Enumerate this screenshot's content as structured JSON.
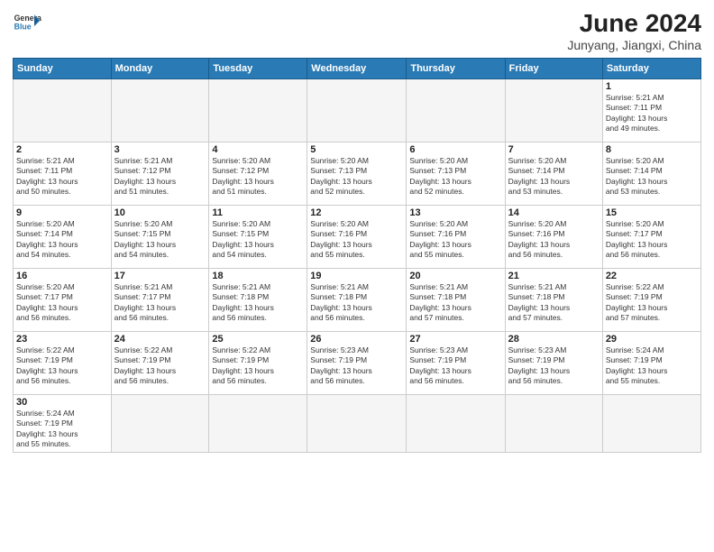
{
  "header": {
    "logo_general": "General",
    "logo_blue": "Blue",
    "month_year": "June 2024",
    "location": "Junyang, Jiangxi, China"
  },
  "days_of_week": [
    "Sunday",
    "Monday",
    "Tuesday",
    "Wednesday",
    "Thursday",
    "Friday",
    "Saturday"
  ],
  "weeks": [
    {
      "days": [
        {
          "num": "",
          "info": "",
          "empty": true
        },
        {
          "num": "",
          "info": "",
          "empty": true
        },
        {
          "num": "",
          "info": "",
          "empty": true
        },
        {
          "num": "",
          "info": "",
          "empty": true
        },
        {
          "num": "",
          "info": "",
          "empty": true
        },
        {
          "num": "",
          "info": "",
          "empty": true
        },
        {
          "num": "1",
          "info": "Sunrise: 5:21 AM\nSunset: 7:11 PM\nDaylight: 13 hours\nand 49 minutes.",
          "empty": false
        }
      ]
    },
    {
      "days": [
        {
          "num": "2",
          "info": "Sunrise: 5:21 AM\nSunset: 7:11 PM\nDaylight: 13 hours\nand 50 minutes.",
          "empty": false
        },
        {
          "num": "3",
          "info": "Sunrise: 5:21 AM\nSunset: 7:12 PM\nDaylight: 13 hours\nand 51 minutes.",
          "empty": false
        },
        {
          "num": "4",
          "info": "Sunrise: 5:20 AM\nSunset: 7:12 PM\nDaylight: 13 hours\nand 51 minutes.",
          "empty": false
        },
        {
          "num": "5",
          "info": "Sunrise: 5:20 AM\nSunset: 7:13 PM\nDaylight: 13 hours\nand 52 minutes.",
          "empty": false
        },
        {
          "num": "6",
          "info": "Sunrise: 5:20 AM\nSunset: 7:13 PM\nDaylight: 13 hours\nand 52 minutes.",
          "empty": false
        },
        {
          "num": "7",
          "info": "Sunrise: 5:20 AM\nSunset: 7:14 PM\nDaylight: 13 hours\nand 53 minutes.",
          "empty": false
        },
        {
          "num": "8",
          "info": "Sunrise: 5:20 AM\nSunset: 7:14 PM\nDaylight: 13 hours\nand 53 minutes.",
          "empty": false
        }
      ]
    },
    {
      "days": [
        {
          "num": "9",
          "info": "Sunrise: 5:20 AM\nSunset: 7:14 PM\nDaylight: 13 hours\nand 54 minutes.",
          "empty": false
        },
        {
          "num": "10",
          "info": "Sunrise: 5:20 AM\nSunset: 7:15 PM\nDaylight: 13 hours\nand 54 minutes.",
          "empty": false
        },
        {
          "num": "11",
          "info": "Sunrise: 5:20 AM\nSunset: 7:15 PM\nDaylight: 13 hours\nand 54 minutes.",
          "empty": false
        },
        {
          "num": "12",
          "info": "Sunrise: 5:20 AM\nSunset: 7:16 PM\nDaylight: 13 hours\nand 55 minutes.",
          "empty": false
        },
        {
          "num": "13",
          "info": "Sunrise: 5:20 AM\nSunset: 7:16 PM\nDaylight: 13 hours\nand 55 minutes.",
          "empty": false
        },
        {
          "num": "14",
          "info": "Sunrise: 5:20 AM\nSunset: 7:16 PM\nDaylight: 13 hours\nand 56 minutes.",
          "empty": false
        },
        {
          "num": "15",
          "info": "Sunrise: 5:20 AM\nSunset: 7:17 PM\nDaylight: 13 hours\nand 56 minutes.",
          "empty": false
        }
      ]
    },
    {
      "days": [
        {
          "num": "16",
          "info": "Sunrise: 5:20 AM\nSunset: 7:17 PM\nDaylight: 13 hours\nand 56 minutes.",
          "empty": false
        },
        {
          "num": "17",
          "info": "Sunrise: 5:21 AM\nSunset: 7:17 PM\nDaylight: 13 hours\nand 56 minutes.",
          "empty": false
        },
        {
          "num": "18",
          "info": "Sunrise: 5:21 AM\nSunset: 7:18 PM\nDaylight: 13 hours\nand 56 minutes.",
          "empty": false
        },
        {
          "num": "19",
          "info": "Sunrise: 5:21 AM\nSunset: 7:18 PM\nDaylight: 13 hours\nand 56 minutes.",
          "empty": false
        },
        {
          "num": "20",
          "info": "Sunrise: 5:21 AM\nSunset: 7:18 PM\nDaylight: 13 hours\nand 57 minutes.",
          "empty": false
        },
        {
          "num": "21",
          "info": "Sunrise: 5:21 AM\nSunset: 7:18 PM\nDaylight: 13 hours\nand 57 minutes.",
          "empty": false
        },
        {
          "num": "22",
          "info": "Sunrise: 5:22 AM\nSunset: 7:19 PM\nDaylight: 13 hours\nand 57 minutes.",
          "empty": false
        }
      ]
    },
    {
      "days": [
        {
          "num": "23",
          "info": "Sunrise: 5:22 AM\nSunset: 7:19 PM\nDaylight: 13 hours\nand 56 minutes.",
          "empty": false
        },
        {
          "num": "24",
          "info": "Sunrise: 5:22 AM\nSunset: 7:19 PM\nDaylight: 13 hours\nand 56 minutes.",
          "empty": false
        },
        {
          "num": "25",
          "info": "Sunrise: 5:22 AM\nSunset: 7:19 PM\nDaylight: 13 hours\nand 56 minutes.",
          "empty": false
        },
        {
          "num": "26",
          "info": "Sunrise: 5:23 AM\nSunset: 7:19 PM\nDaylight: 13 hours\nand 56 minutes.",
          "empty": false
        },
        {
          "num": "27",
          "info": "Sunrise: 5:23 AM\nSunset: 7:19 PM\nDaylight: 13 hours\nand 56 minutes.",
          "empty": false
        },
        {
          "num": "28",
          "info": "Sunrise: 5:23 AM\nSunset: 7:19 PM\nDaylight: 13 hours\nand 56 minutes.",
          "empty": false
        },
        {
          "num": "29",
          "info": "Sunrise: 5:24 AM\nSunset: 7:19 PM\nDaylight: 13 hours\nand 55 minutes.",
          "empty": false
        }
      ]
    },
    {
      "days": [
        {
          "num": "30",
          "info": "Sunrise: 5:24 AM\nSunset: 7:19 PM\nDaylight: 13 hours\nand 55 minutes.",
          "empty": false
        },
        {
          "num": "",
          "info": "",
          "empty": true
        },
        {
          "num": "",
          "info": "",
          "empty": true
        },
        {
          "num": "",
          "info": "",
          "empty": true
        },
        {
          "num": "",
          "info": "",
          "empty": true
        },
        {
          "num": "",
          "info": "",
          "empty": true
        },
        {
          "num": "",
          "info": "",
          "empty": true
        }
      ]
    }
  ]
}
